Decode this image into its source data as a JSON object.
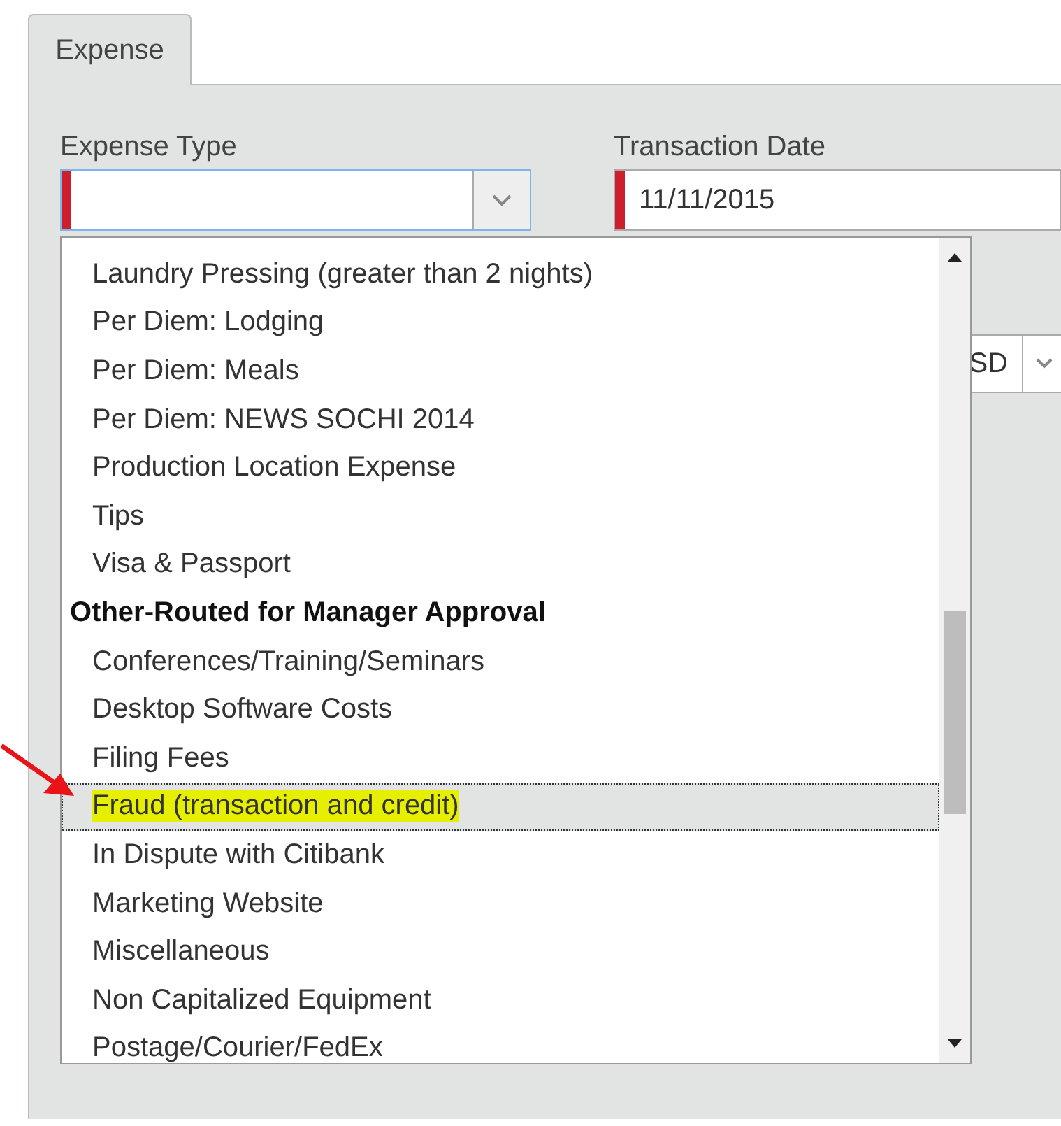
{
  "tabs": [
    {
      "label": "Expense",
      "selected": true
    }
  ],
  "fields": {
    "expense_type": {
      "label": "Expense Type",
      "required": true
    },
    "transaction_date": {
      "label": "Transaction Date",
      "value": "11/11/2015",
      "required": true
    },
    "currency": {
      "value": "SD"
    }
  },
  "dropdown": {
    "items": [
      {
        "kind": "option",
        "label": "Laundry Pressing (greater than 2 nights)",
        "selected": false,
        "highlighted": false
      },
      {
        "kind": "option",
        "label": "Per Diem: Lodging",
        "selected": false,
        "highlighted": false
      },
      {
        "kind": "option",
        "label": "Per Diem: Meals",
        "selected": false,
        "highlighted": false
      },
      {
        "kind": "option",
        "label": "Per Diem: NEWS SOCHI 2014",
        "selected": false,
        "highlighted": false
      },
      {
        "kind": "option",
        "label": "Production Location Expense",
        "selected": false,
        "highlighted": false
      },
      {
        "kind": "option",
        "label": "Tips",
        "selected": false,
        "highlighted": false
      },
      {
        "kind": "option",
        "label": "Visa & Passport",
        "selected": false,
        "highlighted": false
      },
      {
        "kind": "group",
        "label": "Other-Routed for Manager Approval"
      },
      {
        "kind": "option",
        "label": "Conferences/Training/Seminars",
        "selected": false,
        "highlighted": false
      },
      {
        "kind": "option",
        "label": "Desktop Software Costs",
        "selected": false,
        "highlighted": false
      },
      {
        "kind": "option",
        "label": "Filing Fees",
        "selected": false,
        "highlighted": false
      },
      {
        "kind": "option",
        "label": "Fraud (transaction and credit)",
        "selected": true,
        "highlighted": true
      },
      {
        "kind": "option",
        "label": "In Dispute with Citibank",
        "selected": false,
        "highlighted": false
      },
      {
        "kind": "option",
        "label": "Marketing Website",
        "selected": false,
        "highlighted": false
      },
      {
        "kind": "option",
        "label": "Miscellaneous",
        "selected": false,
        "highlighted": false
      },
      {
        "kind": "option",
        "label": "Non Capitalized Equipment",
        "selected": false,
        "highlighted": false
      },
      {
        "kind": "option",
        "label": "Postage/Courier/FedEx",
        "selected": false,
        "highlighted": false
      }
    ]
  }
}
